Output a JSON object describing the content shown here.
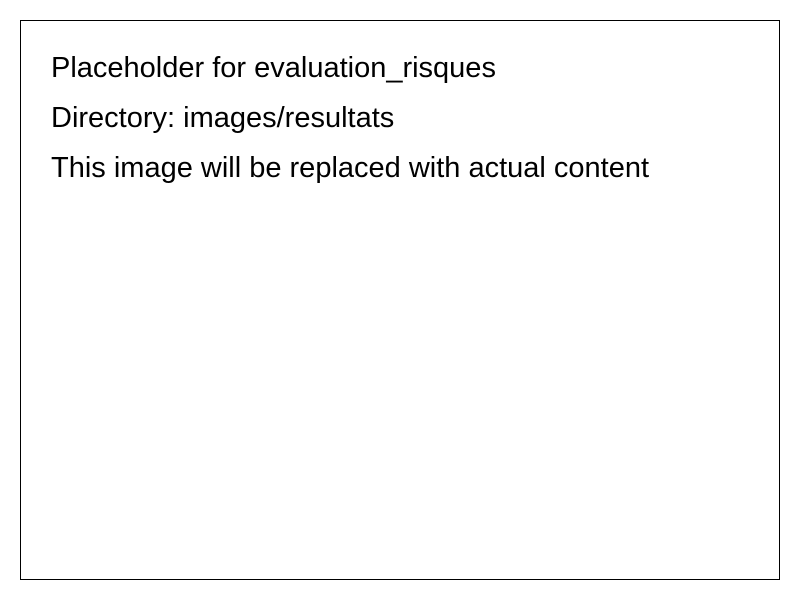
{
  "placeholder": {
    "title": "Placeholder for evaluation_risques",
    "directory": "Directory: images/resultats",
    "note": "This image will be replaced with actual content"
  },
  "colors": {
    "background": "#ffffff",
    "border": "#000000",
    "text": "#000000"
  }
}
